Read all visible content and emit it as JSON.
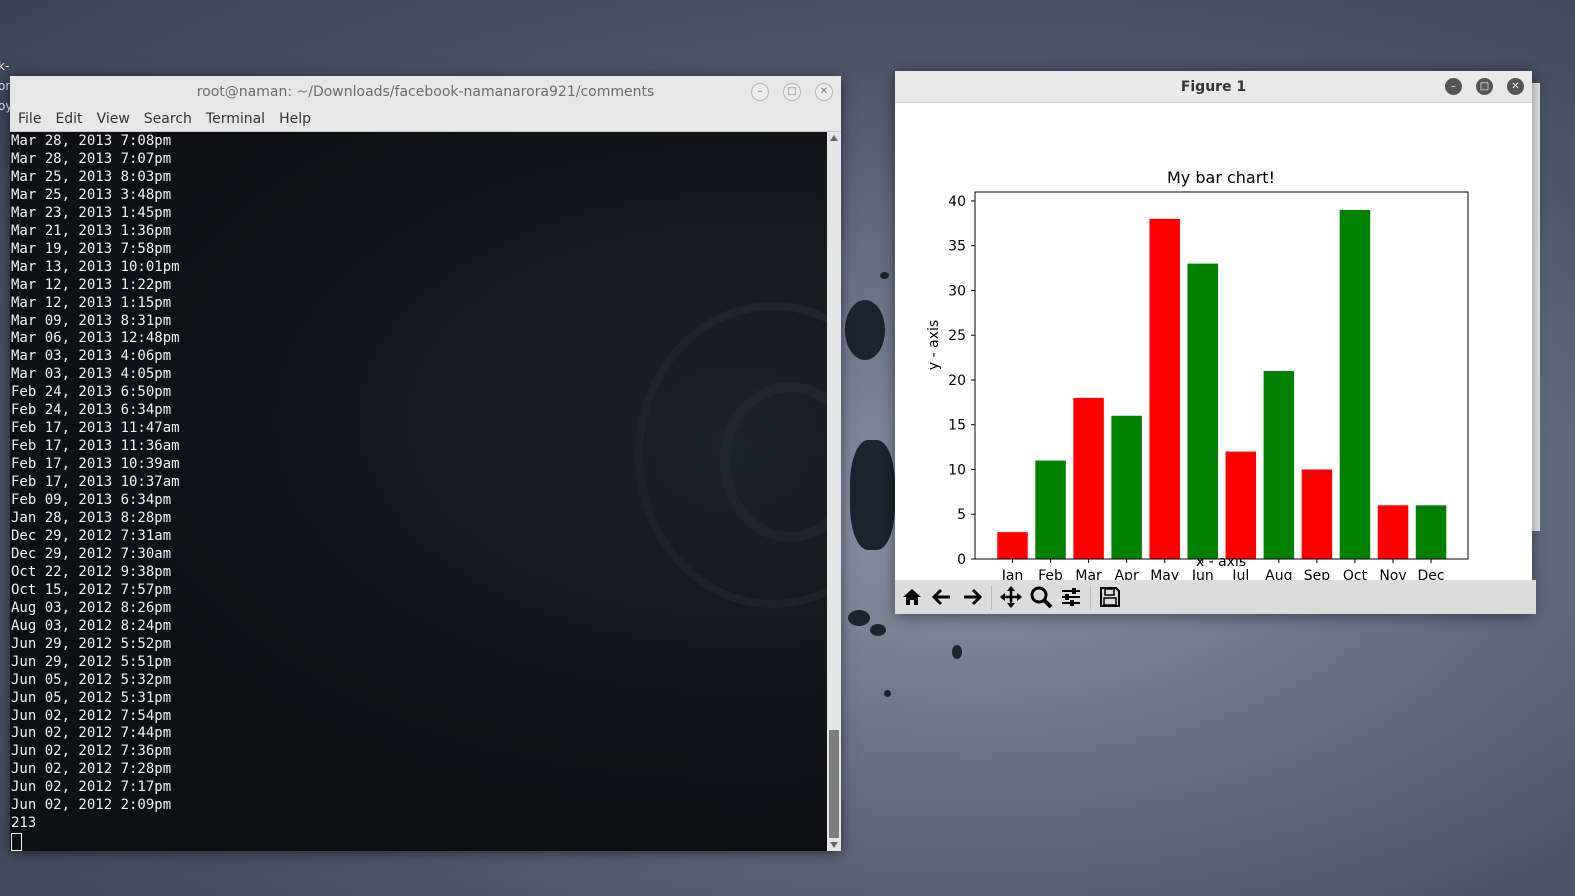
{
  "desktop": {
    "fragment_lines": [
      "k-",
      "or",
      "oy"
    ]
  },
  "terminal": {
    "title": "root@naman: ~/Downloads/facebook-namanarora921/comments",
    "menu": [
      "File",
      "Edit",
      "View",
      "Search",
      "Terminal",
      "Help"
    ],
    "lines": [
      "Mar 28, 2013 7:08pm",
      "Mar 28, 2013 7:07pm",
      "Mar 25, 2013 8:03pm",
      "Mar 25, 2013 3:48pm",
      "Mar 23, 2013 1:45pm",
      "Mar 21, 2013 1:36pm",
      "Mar 19, 2013 7:58pm",
      "Mar 13, 2013 10:01pm",
      "Mar 12, 2013 1:22pm",
      "Mar 12, 2013 1:15pm",
      "Mar 09, 2013 8:31pm",
      "Mar 06, 2013 12:48pm",
      "Mar 03, 2013 4:06pm",
      "Mar 03, 2013 4:05pm",
      "Feb 24, 2013 6:50pm",
      "Feb 24, 2013 6:34pm",
      "Feb 17, 2013 11:47am",
      "Feb 17, 2013 11:36am",
      "Feb 17, 2013 10:39am",
      "Feb 17, 2013 10:37am",
      "Feb 09, 2013 6:34pm",
      "Jan 28, 2013 8:28pm",
      "Dec 29, 2012 7:31am",
      "Dec 29, 2012 7:30am",
      "Oct 22, 2012 9:38pm",
      "Oct 15, 2012 7:57pm",
      "Aug 03, 2012 8:26pm",
      "Aug 03, 2012 8:24pm",
      "Jun 29, 2012 5:52pm",
      "Jun 29, 2012 5:51pm",
      "Jun 05, 2012 5:32pm",
      "Jun 05, 2012 5:31pm",
      "Jun 02, 2012 7:54pm",
      "Jun 02, 2012 7:44pm",
      "Jun 02, 2012 7:36pm",
      "Jun 02, 2012 7:28pm",
      "Jun 02, 2012 7:17pm",
      "Jun 02, 2012 2:09pm",
      "213"
    ]
  },
  "figure": {
    "title": "Figure 1",
    "toolbar_icons": [
      "home-icon",
      "back-arrow-icon",
      "forward-arrow-icon",
      "pan-icon",
      "zoom-icon",
      "configure-subplots-icon",
      "save-icon"
    ]
  },
  "chart_data": {
    "type": "bar",
    "title": "My bar chart!",
    "xlabel": "x - axis",
    "ylabel": "y - axis",
    "categories": [
      "Jan",
      "Feb",
      "Mar",
      "Apr",
      "May",
      "Jun",
      "Jul",
      "Aug",
      "Sep",
      "Oct",
      "Nov",
      "Dec"
    ],
    "values": [
      3,
      11,
      18,
      16,
      38,
      33,
      12,
      21,
      10,
      39,
      6,
      6
    ],
    "colors": [
      "#ff0000",
      "#008000",
      "#ff0000",
      "#008000",
      "#ff0000",
      "#008000",
      "#ff0000",
      "#008000",
      "#ff0000",
      "#008000",
      "#ff0000",
      "#008000"
    ],
    "ylim": [
      0,
      41
    ],
    "yticks": [
      0,
      5,
      10,
      15,
      20,
      25,
      30,
      35,
      40
    ],
    "grid": false
  }
}
